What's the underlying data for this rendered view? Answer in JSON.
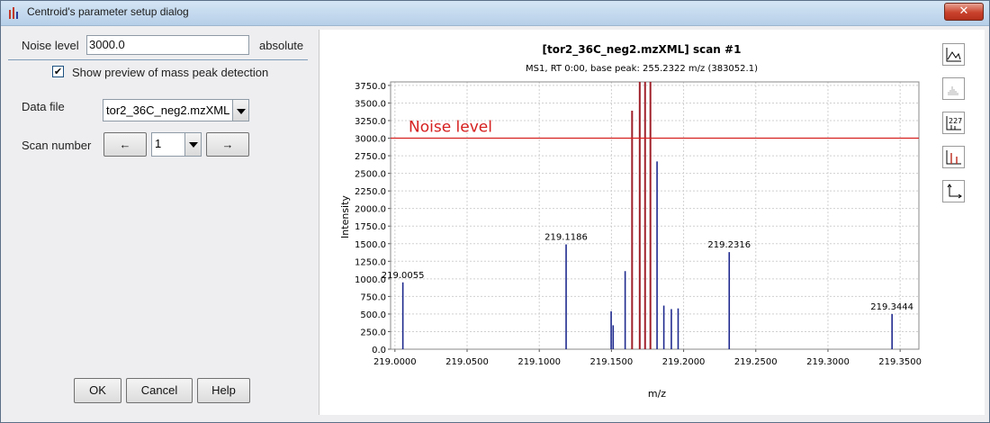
{
  "window": {
    "title": "Centroid's parameter setup dialog",
    "close_label": "✕"
  },
  "form": {
    "noise_level_label": "Noise level",
    "noise_level_value": "3000.0",
    "noise_level_unit": "absolute",
    "show_preview_label": "Show preview of mass peak detection",
    "show_preview_checked": true,
    "data_file_label": "Data file",
    "data_file_value": "tor2_36C_neg2.mzXML",
    "scan_number_label": "Scan number",
    "scan_number_value": "1",
    "prev_label": "←",
    "next_label": "→"
  },
  "buttons": {
    "ok": "OK",
    "cancel": "Cancel",
    "help": "Help"
  },
  "toolbar": [
    {
      "name": "continuous-mode-icon"
    },
    {
      "name": "show-data-points-icon",
      "disabled": true
    },
    {
      "name": "annotations-icon",
      "text": "227"
    },
    {
      "name": "centroid-mode-icon"
    },
    {
      "name": "axes-setup-icon"
    }
  ],
  "chart_data": {
    "type": "bar",
    "title": "[tor2_36C_neg2.mzXML] scan #1",
    "subtitle": "MS1, RT 0:00, base peak: 255.2322 m/z (383052.1)",
    "xlabel": "m/z",
    "ylabel": "Intensity",
    "xlim": [
      218.997,
      219.363
    ],
    "ylim": [
      0,
      3800
    ],
    "x_ticks": [
      "219.0000",
      "219.0500",
      "219.1000",
      "219.1500",
      "219.2000",
      "219.2500",
      "219.3000",
      "219.3500"
    ],
    "y_ticks": [
      "0.0",
      "250.0",
      "500.0",
      "750.0",
      "1000.0",
      "1250.0",
      "1500.0",
      "1750.0",
      "2000.0",
      "2250.0",
      "2500.0",
      "2750.0",
      "3000.0",
      "3250.0",
      "3500.0",
      "3750.0"
    ],
    "noise_level": 3000,
    "noise_label": "Noise level",
    "grid": true,
    "peaks": [
      {
        "x": 219.0055,
        "y": 950,
        "label": "219.0055"
      },
      {
        "x": 219.1186,
        "y": 1490,
        "label": "219.1186"
      },
      {
        "x": 219.1498,
        "y": 540
      },
      {
        "x": 219.1512,
        "y": 340
      },
      {
        "x": 219.1595,
        "y": 1110
      },
      {
        "x": 219.1643,
        "y": 3390,
        "above": true
      },
      {
        "x": 219.1696,
        "y": 3800,
        "above": true
      },
      {
        "x": 219.1733,
        "y": 3800,
        "above": true
      },
      {
        "x": 219.177,
        "y": 3800,
        "above": true
      },
      {
        "x": 219.1816,
        "y": 2670
      },
      {
        "x": 219.1863,
        "y": 620
      },
      {
        "x": 219.1915,
        "y": 570
      },
      {
        "x": 219.1962,
        "y": 580
      },
      {
        "x": 219.2316,
        "y": 1380,
        "label": "219.2316"
      },
      {
        "x": 219.3444,
        "y": 500,
        "label": "219.3444"
      }
    ]
  }
}
